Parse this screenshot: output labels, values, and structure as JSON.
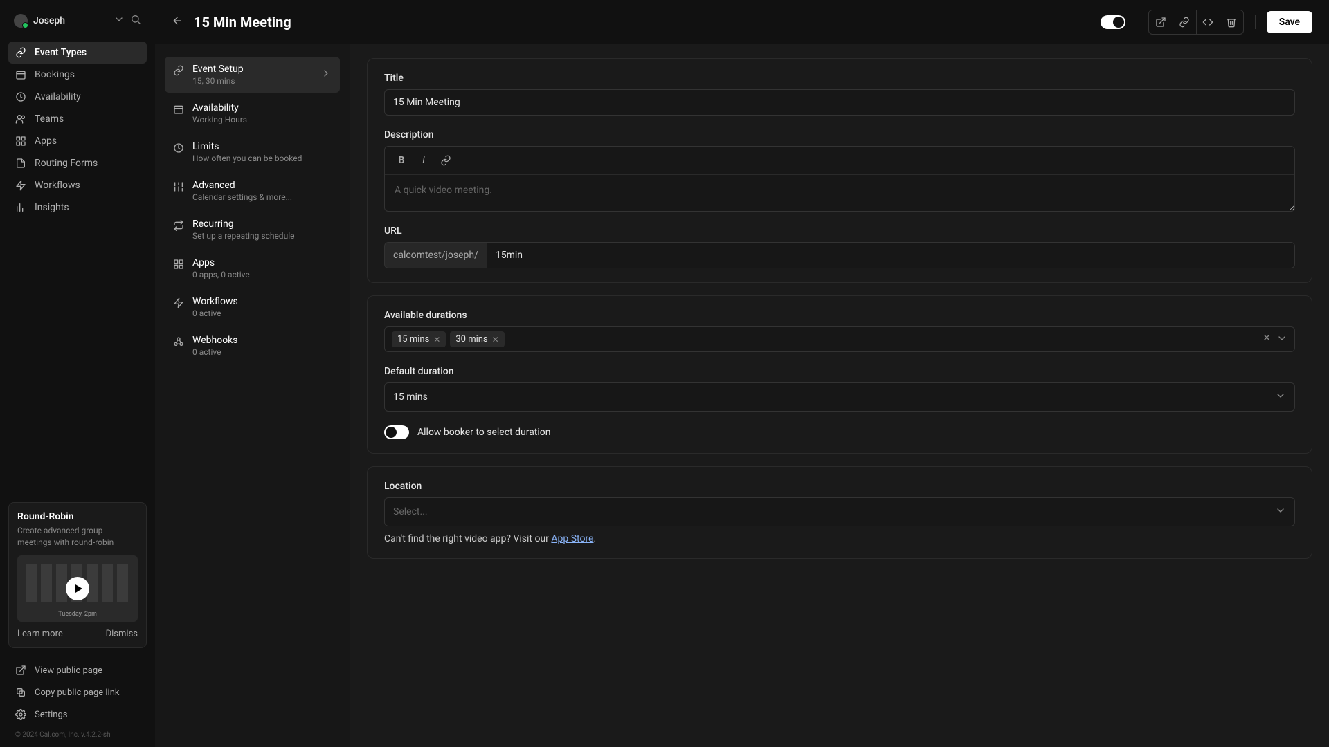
{
  "user": {
    "name": "Joseph"
  },
  "nav": [
    {
      "label": "Event Types",
      "icon": "link-icon"
    },
    {
      "label": "Bookings",
      "icon": "calendar-icon"
    },
    {
      "label": "Availability",
      "icon": "clock-icon"
    },
    {
      "label": "Teams",
      "icon": "users-icon"
    },
    {
      "label": "Apps",
      "icon": "grid-icon"
    },
    {
      "label": "Routing Forms",
      "icon": "file-icon"
    },
    {
      "label": "Workflows",
      "icon": "zap-icon"
    },
    {
      "label": "Insights",
      "icon": "chart-icon"
    }
  ],
  "promo": {
    "title": "Round-Robin",
    "desc": "Create advanced group meetings with round-robin",
    "thumb_caption": "Tuesday, 2pm",
    "learn": "Learn more",
    "dismiss": "Dismiss"
  },
  "bottom": {
    "view": "View public page",
    "copy": "Copy public page link",
    "settings": "Settings"
  },
  "copyright": "© 2024 Cal.com, Inc. v.4.2.2-sh",
  "header": {
    "title": "15 Min Meeting",
    "save": "Save"
  },
  "subnav": [
    {
      "label": "Event Setup",
      "desc": "15, 30 mins",
      "icon": "link-icon"
    },
    {
      "label": "Availability",
      "desc": "Working Hours",
      "icon": "calendar-icon"
    },
    {
      "label": "Limits",
      "desc": "How often you can be booked",
      "icon": "clock-icon"
    },
    {
      "label": "Advanced",
      "desc": "Calendar settings & more...",
      "icon": "sliders-icon"
    },
    {
      "label": "Recurring",
      "desc": "Set up a repeating schedule",
      "icon": "repeat-icon"
    },
    {
      "label": "Apps",
      "desc": "0 apps, 0 active",
      "icon": "grid-icon"
    },
    {
      "label": "Workflows",
      "desc": "0 active",
      "icon": "zap-icon"
    },
    {
      "label": "Webhooks",
      "desc": "0 active",
      "icon": "webhook-icon"
    }
  ],
  "form": {
    "title_label": "Title",
    "title_value": "15 Min Meeting",
    "desc_label": "Description",
    "desc_placeholder": "A quick video meeting.",
    "url_label": "URL",
    "url_prefix": "calcomtest/joseph/",
    "url_value": "15min",
    "durations_label": "Available durations",
    "durations": [
      "15 mins",
      "30 mins"
    ],
    "default_duration_label": "Default duration",
    "default_duration_value": "15 mins",
    "allow_label": "Allow booker to select duration",
    "location_label": "Location",
    "location_placeholder": "Select...",
    "hint_prefix": "Can't find the right video app? Visit our ",
    "hint_link": "App Store",
    "hint_suffix": "."
  }
}
